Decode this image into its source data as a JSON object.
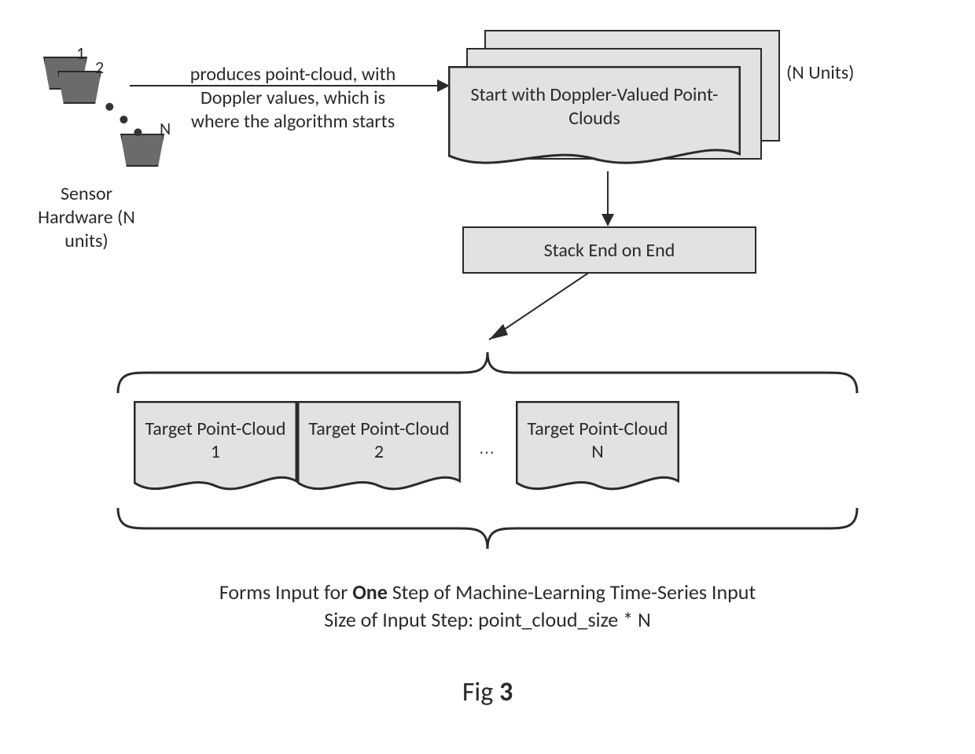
{
  "sensor": {
    "num1": "1",
    "num2": "2",
    "numN": "N",
    "caption": "Sensor Hardware (N units)"
  },
  "produces_text": "produces point-cloud, with Doppler values, which is where the algorithm starts",
  "doppler_doc": {
    "text": "Start with Doppler-Valued Point-Clouds",
    "n_units": "(N Units)"
  },
  "stack_box": "Stack End on End",
  "targets": {
    "t1": "Target Point-Cloud 1",
    "t2": "Target Point-Cloud 2",
    "ellipsis": "⋯",
    "tn": "Target Point-Cloud N"
  },
  "bottom_caption_line1_pre": "Forms Input for ",
  "bottom_caption_line1_bold": "One",
  "bottom_caption_line1_post": " Step of Machine-Learning Time-Series Input",
  "bottom_caption_line2": "Size of Input Step: point_cloud_size * N",
  "fig_pre": "Fig ",
  "fig_num": "3"
}
